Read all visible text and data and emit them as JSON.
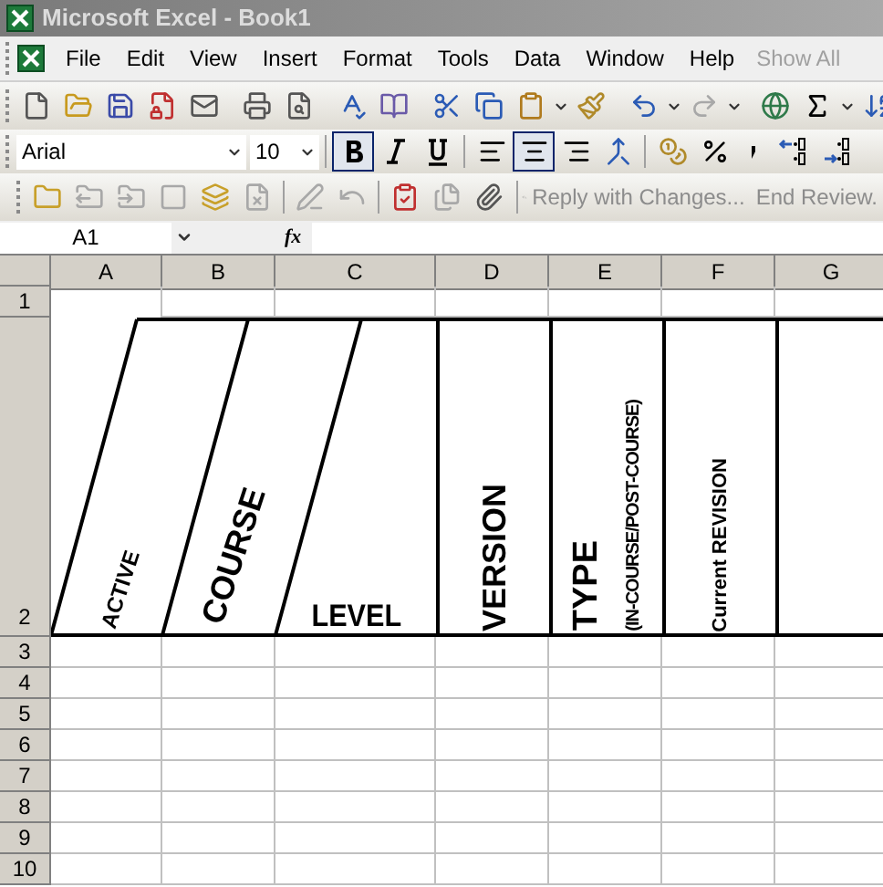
{
  "window": {
    "title": "Microsoft Excel - Book1"
  },
  "menu": [
    {
      "label": "File"
    },
    {
      "label": "Edit"
    },
    {
      "label": "View"
    },
    {
      "label": "Insert"
    },
    {
      "label": "Format"
    },
    {
      "label": "Tools"
    },
    {
      "label": "Data"
    },
    {
      "label": "Window"
    },
    {
      "label": "Help"
    }
  ],
  "show_all": {
    "label": "Show All",
    "disabled": true
  },
  "formatting_toolbar": {
    "font": "Arial",
    "size": "10",
    "style_buttons": [
      {
        "kind": "bold",
        "selected": true
      },
      {
        "kind": "italic",
        "selected": false
      },
      {
        "kind": "underline",
        "selected": false
      }
    ],
    "align_buttons": [
      {
        "kind": "left",
        "selected": false
      },
      {
        "kind": "center",
        "selected": true
      },
      {
        "kind": "right",
        "selected": false
      }
    ]
  },
  "reviewing_toolbar": {
    "reply": {
      "label": "Reply with Changes...",
      "disabled": true
    },
    "end_review": {
      "label": "End Review.",
      "disabled": true
    }
  },
  "formula_bar": {
    "name_box": "A1",
    "function_label": "fx"
  },
  "sheet": {
    "columns": [
      "A",
      "B",
      "C",
      "D",
      "E",
      "F",
      "G"
    ],
    "rows": [
      "1",
      "2",
      "3",
      "4",
      "5",
      "6",
      "7",
      "8",
      "9",
      "10"
    ],
    "headers": [
      {
        "kind": "angled",
        "text": "ACTIVE"
      },
      {
        "kind": "angled_large",
        "text": "COURSE"
      },
      {
        "kind": "flat",
        "text": "LEVEL"
      },
      {
        "kind": "vertical",
        "text": "VERSION"
      },
      {
        "kind": "vertical_sub",
        "text": "TYPE",
        "subtitle": "(IN-COURSE/POST-COURSE)"
      },
      {
        "kind": "vertical_small",
        "text": "Current REVISION"
      }
    ]
  }
}
